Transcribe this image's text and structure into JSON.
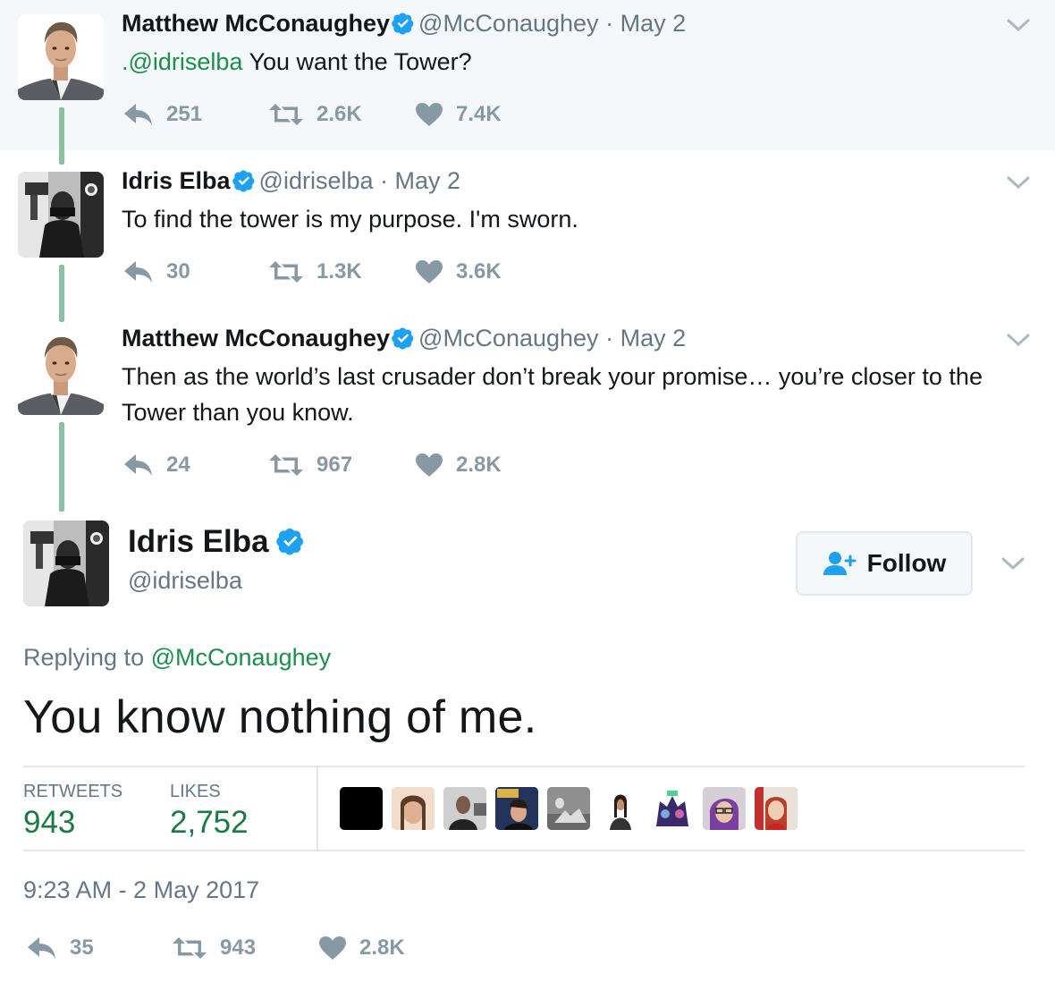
{
  "thread": [
    {
      "name": "Matthew McConaughey",
      "handle": "@McConaughey",
      "separator": "·",
      "date": "May 2",
      "mention": ".@idriselba",
      "text": " You want the Tower?",
      "replies": "251",
      "retweets": "2.6K",
      "likes": "7.4K"
    },
    {
      "name": "Idris Elba",
      "handle": "@idriselba",
      "separator": "·",
      "date": "May 2",
      "text": "To find the tower is my purpose. I'm sworn.",
      "replies": "30",
      "retweets": "1.3K",
      "likes": "3.6K"
    },
    {
      "name": "Matthew McConaughey",
      "handle": "@McConaughey",
      "separator": "·",
      "date": "May 2",
      "text_line1": "Then as the world’s last crusader don’t break your promise… you’re closer to the",
      "text_line2": "Tower than you know.",
      "replies": "24",
      "retweets": "967",
      "likes": "2.8K"
    }
  ],
  "main": {
    "name": "Idris Elba",
    "handle": "@idriselba",
    "follow_label": "Follow",
    "replying_prefix": "Replying to",
    "replying_to": "@McConaughey",
    "text": "You know nothing of me.",
    "retweets_label": "RETWEETS",
    "retweets_value": "943",
    "likes_label": "LIKES",
    "likes_value": "2,752",
    "timestamp": "9:23 AM - 2 May 2017",
    "replies": "35",
    "retweets": "943",
    "likes": "2.8K"
  },
  "colors": {
    "accent_green": "#1b8f4b",
    "verified_blue": "#1da1f2",
    "muted": "#657786",
    "action_gray": "#8899a6"
  },
  "icons": [
    "verified-badge-icon",
    "reply-icon",
    "retweet-icon",
    "heart-icon",
    "chevron-down-icon",
    "follow-person-icon"
  ]
}
